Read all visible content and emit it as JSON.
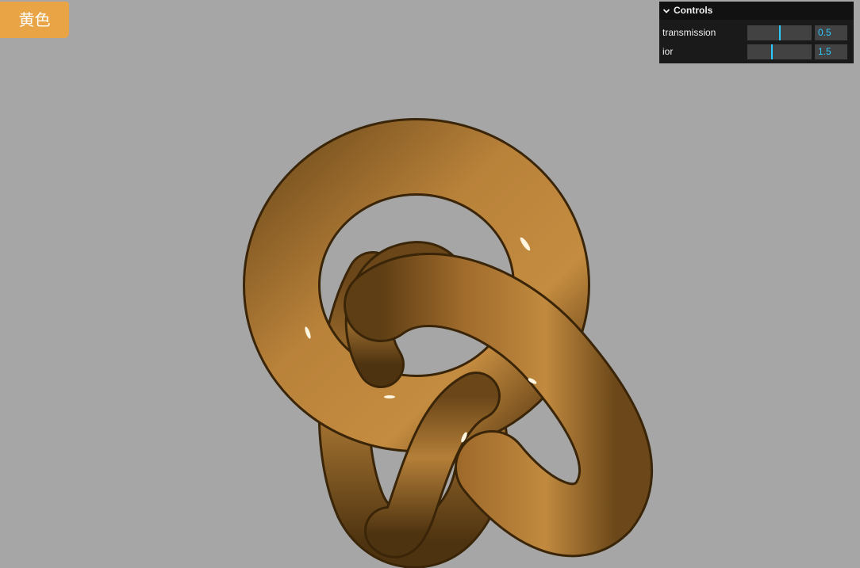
{
  "color_button": {
    "label": "黄色",
    "color": "#e8a445"
  },
  "gui": {
    "title": "Controls",
    "controls": [
      {
        "label": "transmission",
        "value": "0.5",
        "min": 0,
        "max": 1,
        "level": 0.5
      },
      {
        "label": "ior",
        "value": "1.5",
        "min": 1,
        "max": 2.333,
        "level": 0.375
      }
    ],
    "accent_color": "#2cc9ff"
  },
  "scene": {
    "background": "#a6a6a6",
    "object": "torus-knot",
    "material_color": "#c08a3e"
  }
}
